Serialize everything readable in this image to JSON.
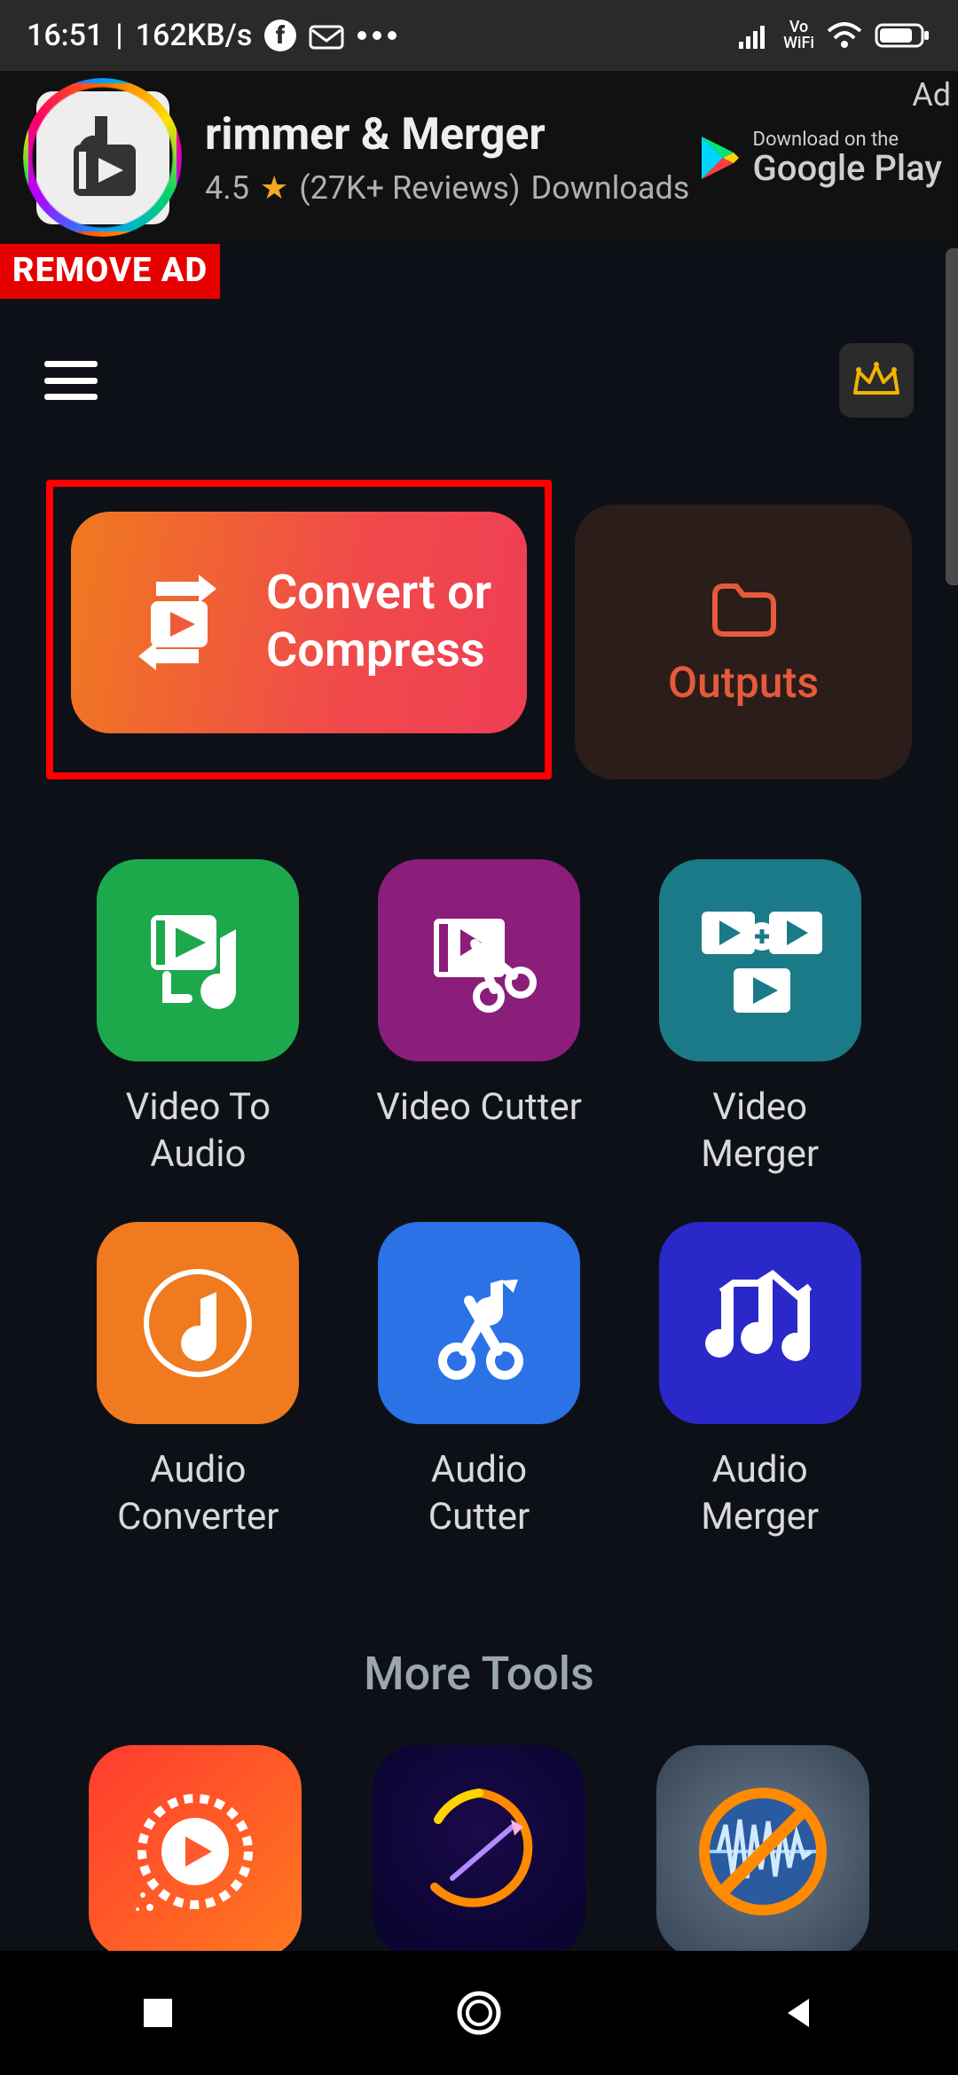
{
  "status": {
    "time": "16:51",
    "netrate": "162KB/s",
    "vowifi": "Vo\nWiFi"
  },
  "ad": {
    "title": "rimmer & Merger",
    "rating": "4.5",
    "reviews": "(27K+ Reviews)",
    "downloads": "Downloads",
    "play_small": "Download on the",
    "play_big": "Google Play",
    "badge": "Ad"
  },
  "remove_ad": "REMOVE AD",
  "hero": {
    "convert_label": "Convert or\nCompress",
    "outputs_label": "Outputs"
  },
  "tools": [
    {
      "label": "Video To\nAudio"
    },
    {
      "label": "Video Cutter"
    },
    {
      "label": "Video\nMerger"
    },
    {
      "label": "Audio\nConverter"
    },
    {
      "label": "Audio\nCutter"
    },
    {
      "label": "Audio\nMerger"
    }
  ],
  "more_tools_title": "More Tools"
}
